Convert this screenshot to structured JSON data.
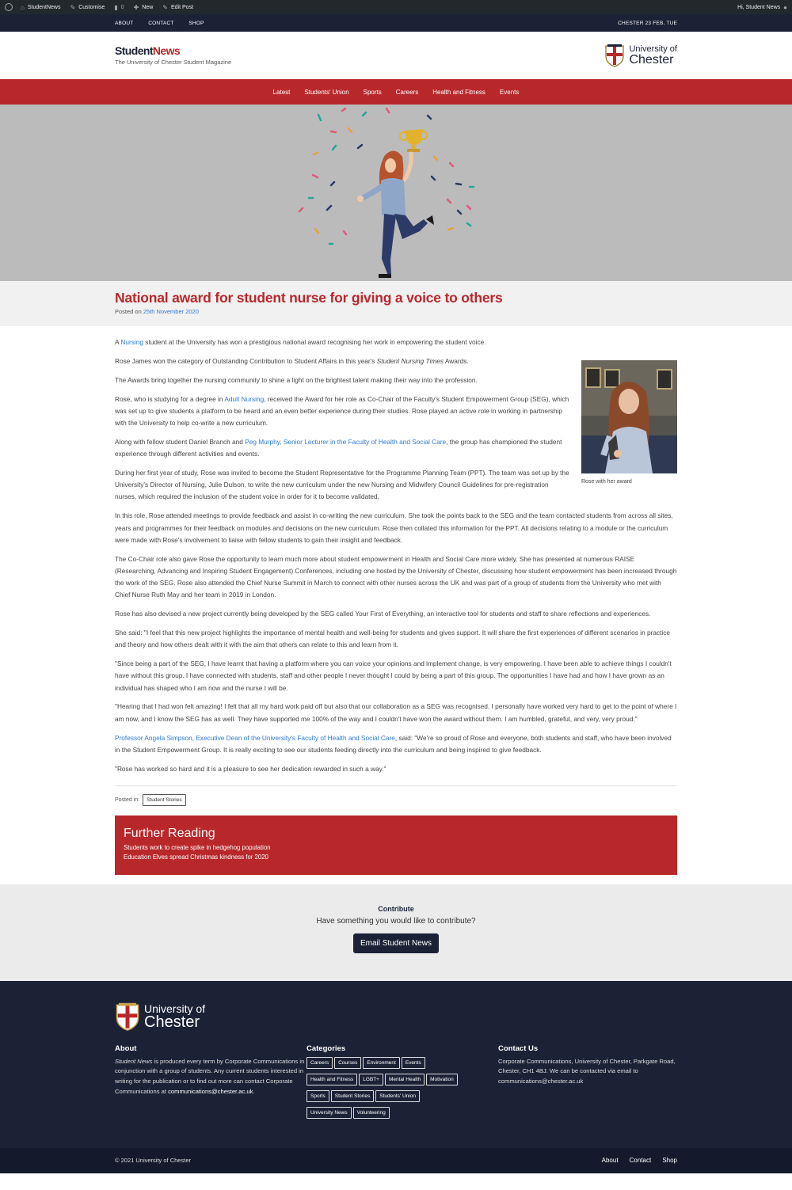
{
  "admin_bar": {
    "site": "StudentNews",
    "customise": "Customise",
    "comments": "0",
    "new": "New",
    "edit": "Edit Post",
    "greeting": "Hi, Student News"
  },
  "topbar": {
    "links": [
      "ABOUT",
      "CONTACT",
      "SHOP"
    ],
    "date": "CHESTER 23 FEB, TUE"
  },
  "header": {
    "logo_student": "Student",
    "logo_news": "News",
    "tagline": "The University of Chester Student Magazine",
    "uni_line1": "University of",
    "uni_line2": "Chester"
  },
  "nav": {
    "items": [
      "Latest",
      "Students' Union",
      "Sports",
      "Careers",
      "Health and Fitness",
      "Events"
    ]
  },
  "article": {
    "title": "National award for student nurse for giving a voice to others",
    "posted_prefix": "Posted on ",
    "posted_date": "25th November 2020",
    "figure_caption": "Rose with her award",
    "p1_pre": "A ",
    "p1_link": "Nursing",
    "p1_post": " student at the University has won a prestigious national award recognising her work in empowering the student voice.",
    "p2_pre": "Rose James won the category of Outstanding Contribution to Student Affairs in this year's ",
    "p2_em": "Student Nursing Times",
    "p2_post": " Awards.",
    "p3": "The Awards bring together the nursing community to shine a light on the brightest talent making their way into the profession.",
    "p4_pre": "Rose, who is studying for a degree in ",
    "p4_link": "Adult Nursing",
    "p4_post": ", received the Award for her role as Co-Chair of the Faculty's Student Empowerment Group (SEG), which was set up to give students a platform to be heard and an even better experience during their studies. Rose played an active role in working in partnership with the University to help co-write a new curriculum.",
    "p5_pre": "Along with fellow student Daniel Branch and ",
    "p5_link": "Peg Murphy, Senior Lecturer in the Faculty of Health and Social Care",
    "p5_post": ", the group has championed the student experience through different activities and events.",
    "p6": "During her first year of study, Rose was invited to become the Student Representative for the Programme Planning Team (PPT). The team was set up by the University's Director of Nursing, Julie Dulson, to write the new curriculum under the new Nursing and Midwifery Council Guidelines for pre-registration nurses, which required the inclusion of the student voice in order for it to become validated.",
    "p7": "In this role, Rose attended meetings to provide feedback and assist in co-writing the new curriculum. She took the points back to the SEG and the team contacted students from across all sites, years and programmes for their feedback on modules and decisions on the new curriculum. Rose then collated this information for the PPT. All decisions relating to a module or the curriculum were made with Rose's involvement to liaise with fellow students to gain their insight and feedback.",
    "p8": "The Co-Chair role also gave Rose the opportunity to learn much more about student empowerment in Health and Social Care more widely. She has presented at numerous RAISE (Researching, Advancing and Inspiring Student Engagement) Conferences, including one hosted by the University of Chester, discussing how student empowerment has been increased through the work of the SEG. Rose also attended the Chief Nurse Summit in March to connect with other nurses across the UK and was part of a group of students from the University who met with Chief Nurse Ruth May and her team in 2019 in London.",
    "p9": "Rose has also devised a new project currently being developed by the SEG called Your First of Everything, an interactive tool for students and staff to share reflections and experiences.",
    "p10": "She said: \"I feel that this new project highlights the importance of mental health and well-being for students and gives support. It will share the first experiences of different scenarios in practice and theory and how others dealt with it with the aim that others can relate to this and learn from it.",
    "p11": "\"Since being a part of the SEG, I have learnt that having a platform where you can voice your opinions and implement change, is very empowering. I have been able to achieve things I couldn't have without this group. I have connected with students, staff and other people I never thought I could by being a part of this group. The opportunities I have had and how I have grown as an individual has shaped who I am now and the nurse I will be.",
    "p12": "\"Hearing that I had won felt amazing! I felt that all my hard work paid off but also that our collaboration as a SEG was recognised. I personally have worked very hard to get to the point of where I am now, and I know the SEG has as well. They have supported me 100% of the way and I couldn't have won the award without them. I am humbled, grateful, and very, very proud.\"",
    "p13_link": "Professor Angela Simpson, Executive Dean of the University's Faculty of Health and Social Care",
    "p13_post": ", said: \"We're so proud of Rose and everyone, both students and staff, who have been involved in the Student Empowerment Group. It is really exciting to see our students feeding directly into the curriculum and being inspired to give feedback.",
    "p14": "\"Rose has worked so hard and it is a pleasure to see her dedication rewarded in such a way.\"",
    "posted_in": "Posted in:",
    "category": "Student Stories"
  },
  "further_reading": {
    "title": "Further Reading",
    "items": [
      "Students work to create spike in hedgehog population",
      "Education Elves spread Christmas kindness for 2020"
    ]
  },
  "contribute": {
    "title": "Contribute",
    "subtitle": "Have something you would like to contribute?",
    "button": "Email Student News"
  },
  "footer": {
    "uni_line1": "University of",
    "uni_line2": "Chester",
    "about_title": "About",
    "about_em": "Student News",
    "about_text": " is produced every term by Corporate Communications in conjunction with a group of students. Any current students interested in writing for the publication or to find out more can contact Corporate Communications at ",
    "about_email": "communications@chester.ac.uk",
    "about_end": ".",
    "categories_title": "Categories",
    "categories": [
      "Careers",
      "Courses",
      "Environment",
      "Events",
      "Health and Fitness",
      "LGBT+",
      "Mental Health",
      "Motivation",
      "Sports",
      "Student Stories",
      "Students' Union",
      "University News",
      "Volunteering"
    ],
    "contact_title": "Contact Us",
    "contact_text": "Corporate Communications, University of Chester, Parkgate Road, Chester, CH1 4BJ. We can be contacted via email to communications@chester.ac.uk"
  },
  "bottom": {
    "copyright": "© 2021 University of Chester",
    "links": [
      "About",
      "Contact",
      "Shop"
    ]
  },
  "colors": {
    "brand_red": "#b8282b",
    "navy": "#1c2236",
    "link_blue": "#2e7bd6"
  }
}
